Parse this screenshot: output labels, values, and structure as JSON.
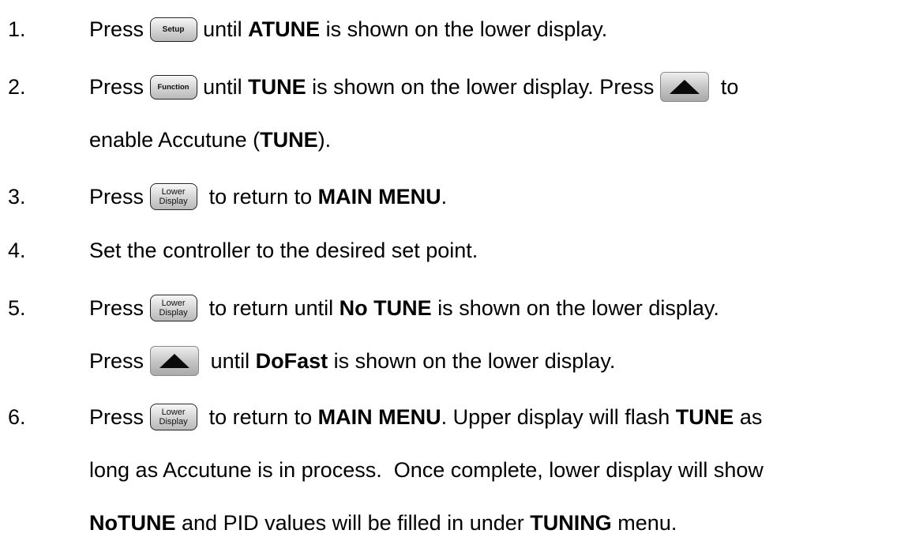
{
  "keys": {
    "setup": "Setup",
    "function": "Function",
    "lower_display_top": "Lower",
    "lower_display_bottom": "Display",
    "up_arrow_icon": "up-arrow-icon"
  },
  "steps": [
    {
      "number": "1.",
      "lines": [
        {
          "press": "Press",
          "after_key": "until",
          "b1": "ATUNE",
          "t1": "is shown on the lower display."
        }
      ]
    },
    {
      "number": "2.",
      "lines": [
        {
          "press": "Press",
          "after_key": "until",
          "b1": "TUNE",
          "t1": "is shown on the lower display.  Press",
          "t2": "to"
        },
        {
          "t0": "enable Accutune (",
          "b1": "TUNE",
          "t1": ")."
        }
      ]
    },
    {
      "number": "3.",
      "lines": [
        {
          "press": "Press",
          "t0": "to return to",
          "b1": "MAIN MENU",
          "t1": "."
        }
      ]
    },
    {
      "number": "4.",
      "lines": [
        {
          "t0": "Set the controller to the desired set point."
        }
      ]
    },
    {
      "number": "5.",
      "lines": [
        {
          "press": "Press",
          "t0": "to return until",
          "b1": "No TUNE",
          "t1": "is shown on the lower display."
        },
        {
          "press": "Press",
          "t0": "until",
          "b1": "DoFast",
          "t1": "is shown on the lower display."
        }
      ]
    },
    {
      "number": "6.",
      "lines": [
        {
          "press": "Press",
          "t0": "to return to",
          "b1": "MAIN MENU",
          "t1": ". Upper display will flash",
          "b2": "TUNE",
          "t2": "as"
        },
        {
          "t0": "long as Accutune is in process.  Once complete, lower display will show"
        },
        {
          "b1": "NoTUNE",
          "t1": "and PID values will be filled in under",
          "b2": "TUNING",
          "t2": "menu."
        }
      ]
    }
  ]
}
